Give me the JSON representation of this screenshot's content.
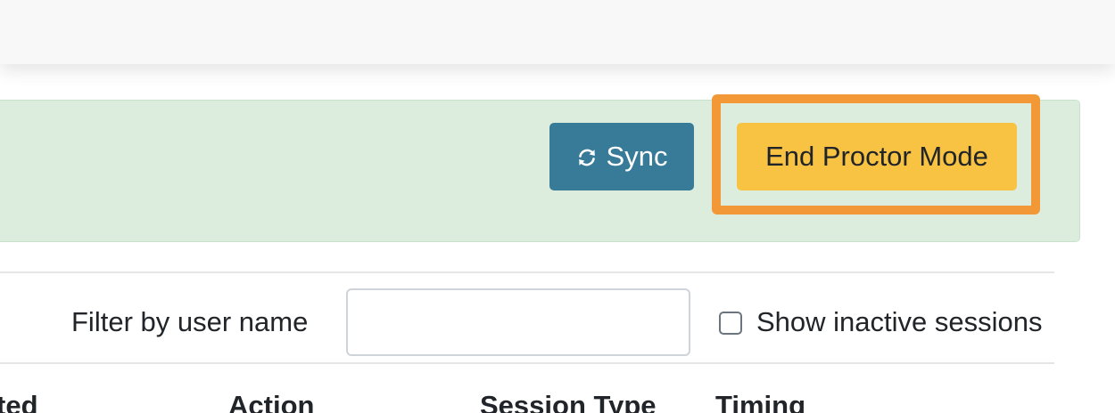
{
  "proctor_panel": {
    "sync_label": "Sync",
    "end_proctor_label": "End Proctor Mode",
    "highlight_color": "#f29837"
  },
  "filters": {
    "filter_label": "Filter by user name",
    "filter_value": "",
    "show_inactive_label": "Show inactive sessions",
    "show_inactive_checked": false
  },
  "table": {
    "headers": [
      "ted",
      "Action",
      "Session Type",
      "Timing"
    ]
  },
  "colors": {
    "sync_button": "#387b99",
    "end_button": "#f8c242",
    "panel_background": "#dcedde",
    "topbar": "#f8f8f8"
  },
  "icons": {
    "sync": "sync-icon"
  }
}
